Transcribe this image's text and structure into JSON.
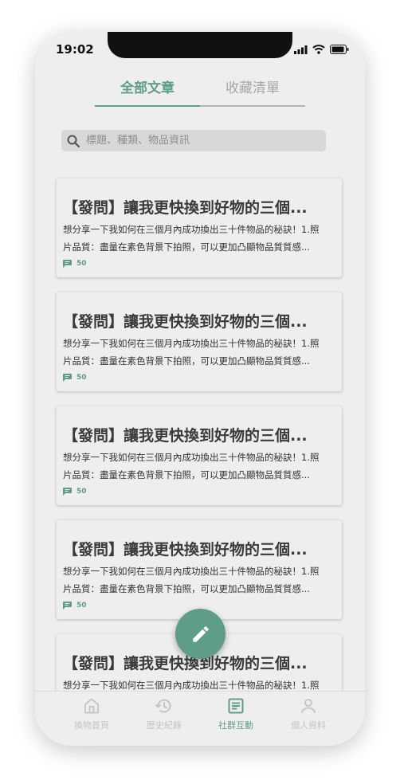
{
  "status_bar": {
    "time": "19:02"
  },
  "tabs": [
    {
      "label": "全部文章",
      "active": true
    },
    {
      "label": "收藏清單",
      "active": false
    }
  ],
  "search": {
    "placeholder": "標題、種類、物品資訊",
    "value": ""
  },
  "articles": [
    {
      "title": "【發問】讓我更快換到好物的三個...",
      "excerpt_line1": "想分享一下我如何在三個月內成功換出三十件物品的秘訣！1.照",
      "excerpt_line2": "片品質：盡量在素色背景下拍照，可以更加凸顯物品質質感...",
      "comment_count": "50"
    },
    {
      "title": "【發問】讓我更快換到好物的三個...",
      "excerpt_line1": "想分享一下我如何在三個月內成功換出三十件物品的秘訣！1.照",
      "excerpt_line2": "片品質：盡量在素色背景下拍照，可以更加凸顯物品質質感...",
      "comment_count": "50"
    },
    {
      "title": "【發問】讓我更快換到好物的三個...",
      "excerpt_line1": "想分享一下我如何在三個月內成功換出三十件物品的秘訣！1.照",
      "excerpt_line2": "片品質：盡量在素色背景下拍照，可以更加凸顯物品質質感...",
      "comment_count": "50"
    },
    {
      "title": "【發問】讓我更快換到好物的三個...",
      "excerpt_line1": "想分享一下我如何在三個月內成功換出三十件物品的秘訣！1.照",
      "excerpt_line2": "片品質：盡量在素色背景下拍照，可以更加凸顯物品質質感...",
      "comment_count": "50"
    },
    {
      "title": "【發問】讓我更快換到好物的三個...",
      "excerpt_line1": "想分享一下我如何在三個月內成功換出三十件物品的秘訣！1.照",
      "excerpt_line2": "",
      "comment_count": ""
    }
  ],
  "fab": {
    "icon": "pencil-icon"
  },
  "bottom_nav": [
    {
      "label": "換物首頁",
      "icon": "home-icon",
      "active": false
    },
    {
      "label": "歷史紀錄",
      "icon": "history-icon",
      "active": false
    },
    {
      "label": "社群互動",
      "icon": "article-icon",
      "active": true
    },
    {
      "label": "個人資料",
      "icon": "person-icon",
      "active": false
    }
  ],
  "colors": {
    "accent": "#5e9e86",
    "background": "#eeeeee",
    "inactive": "#c4c4c4"
  }
}
